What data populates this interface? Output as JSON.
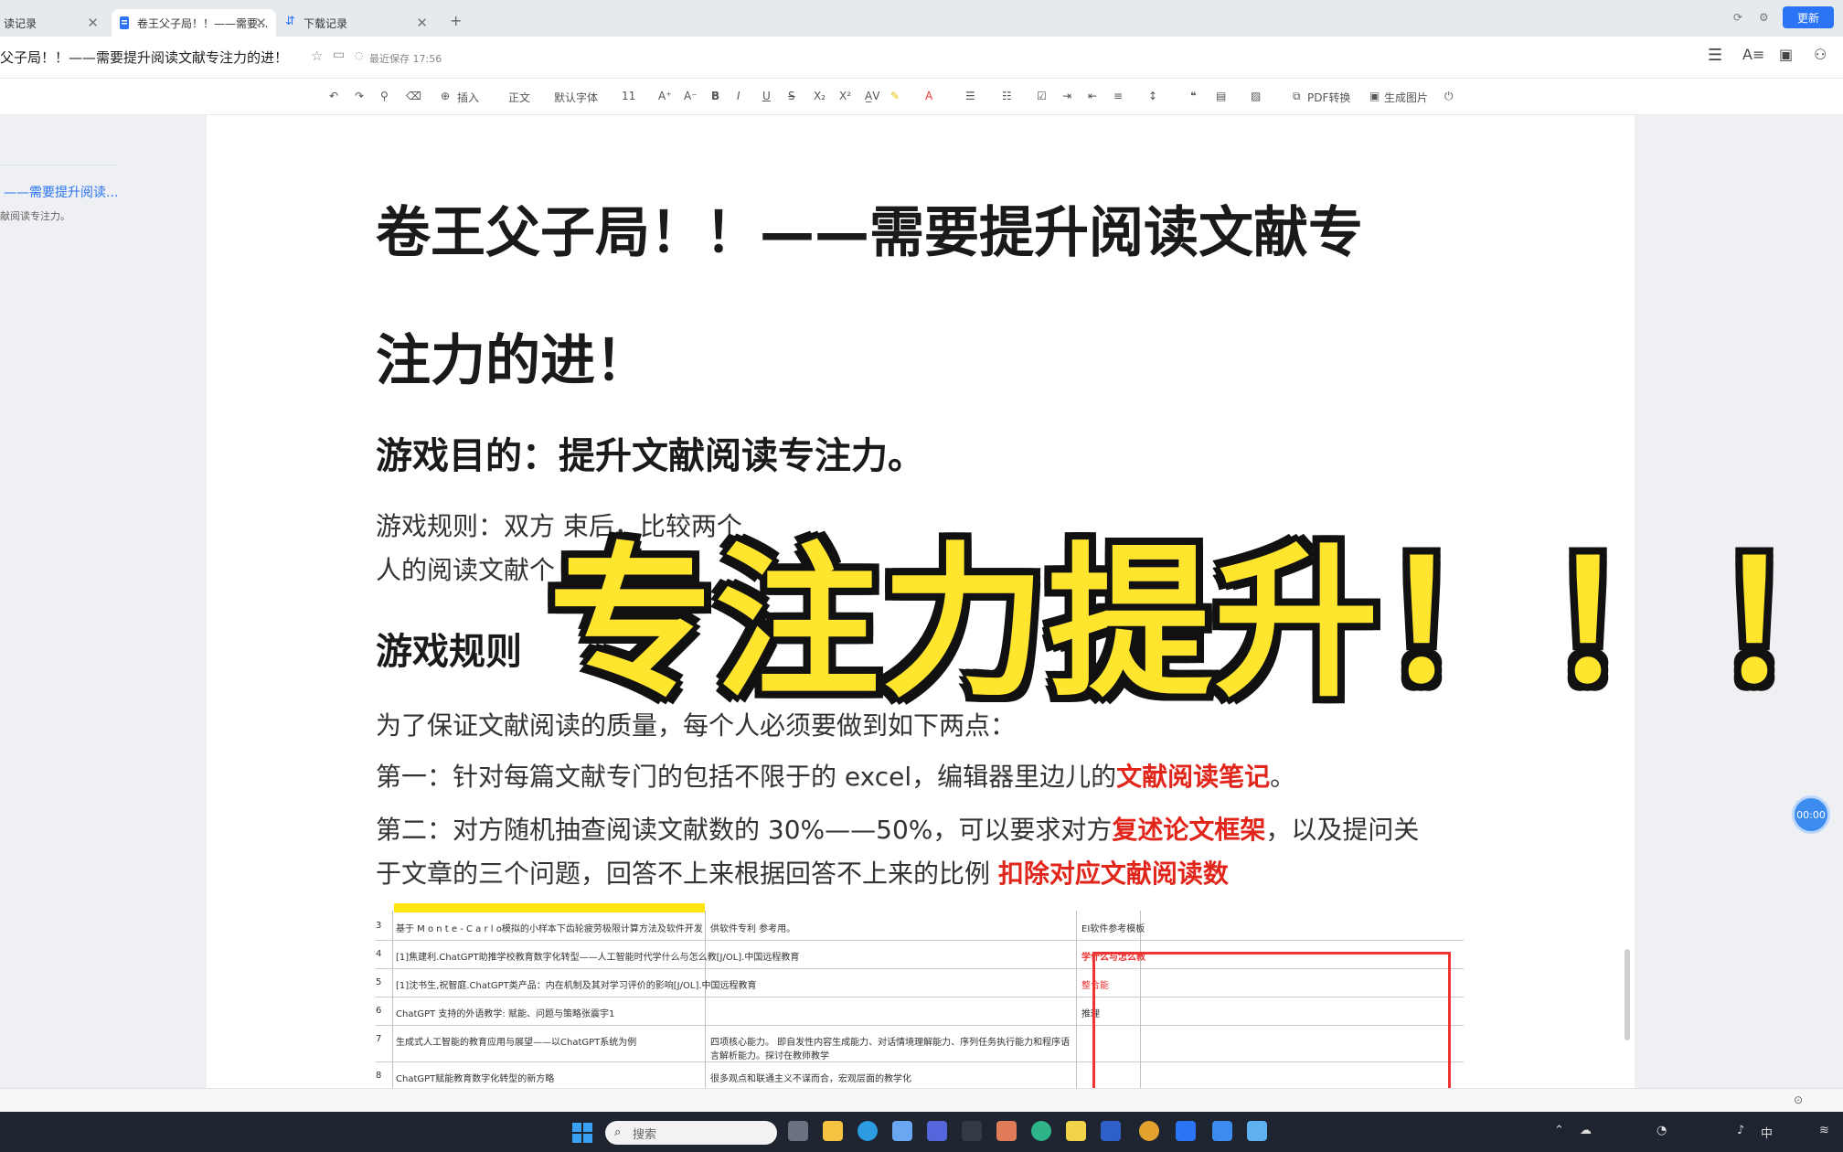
{
  "tabs": [
    {
      "label": "读记录",
      "active": false
    },
    {
      "label": "卷王父子局！！——需要...",
      "active": true
    },
    {
      "label": "下载记录",
      "active": false
    }
  ],
  "header": {
    "update_label": "更新",
    "doc_title": "父子局！！——需要提升阅读文献专注力的进！",
    "save_status": "最近保存 17:56"
  },
  "toolbar": {
    "insert": "插入",
    "style": "正文",
    "font": "默认字体",
    "size": "11",
    "pdf": "PDF转换",
    "image": "生成图片"
  },
  "outline": {
    "item": "——需要提升阅读...",
    "sub": "献阅读专注力。"
  },
  "doc": {
    "h1_line1": "卷王父子局！！——需要提升阅读文献专",
    "h1_line2": "注力的进！",
    "h2_goal": "游戏目的：提升文献阅读专注力。",
    "rule_line1": "游戏规则：双方                                                                                    束后，比较两个",
    "rule_line2": "人的阅读文献个",
    "h2_rules": "游戏规则",
    "p_intro": "为了保证文献阅读的质量，每个人必须要做到如下两点：",
    "p_first_pre": "第一：针对每篇文献专门的包括不限于的 excel，编辑器里边儿的",
    "p_first_red": "文献阅读笔记",
    "p_first_post": "。",
    "p_second_pre": "第二：对方随机抽查阅读文献数的 30%——50%，可以要求对方",
    "p_second_red": "复述论文框架",
    "p_second_post": "，以及提问关",
    "p_third_pre": "于文章的三个问题，回答不上来根据回答不上来的比例 ",
    "p_third_red": "扣除对应文献阅读数"
  },
  "table": {
    "rows": [
      {
        "n": "3",
        "a": "基于 M o n t e - C a r l o模拟的小样本下齿轮疲劳极限计算方法及软件开发",
        "b": "供软件专利 参考用。",
        "c": "EI软件参考模板"
      },
      {
        "n": "4",
        "a": "[1]焦建利.ChatGPT助推学校教育数字化转型——人工智能时代学什么与怎么教[J/OL].中国远程教育",
        "b": "",
        "c": "学什么与怎么教"
      },
      {
        "n": "5",
        "a": "[1]沈书生,祝智庭.ChatGPT类产品：内在机制及其对学习评价的影响[J/OL].中国远程教育",
        "b": "",
        "c": "整合能"
      },
      {
        "n": "6",
        "a": "ChatGPT 支持的外语教学: 赋能、问题与策略张震宇1",
        "b": "",
        "c": "推理"
      },
      {
        "n": "7",
        "a": "生成式人工智能的教育应用与展望——以ChatGPT系统为例",
        "b": "四项核心能力。 即自发性内容生成能力、对话情境理解能力、序列任务执行能力和程序语言解析能力。探讨在教师教学",
        "c": ""
      },
      {
        "n": "8",
        "a": "ChatGPT赋能教育数字化转型的新方略",
        "b": "很多观点和联通主义不谋而合，宏观层面的教学化",
        "c": ""
      }
    ]
  },
  "overlay": {
    "text": "专注力提升！！！"
  },
  "timer": {
    "text": "00:00"
  },
  "taskbar": {
    "search_placeholder": "搜索",
    "ime": "中"
  },
  "colors": {
    "accent": "#2b74f5",
    "emphasis_red": "#e1251b",
    "overlay_yellow": "#ffe52e"
  }
}
